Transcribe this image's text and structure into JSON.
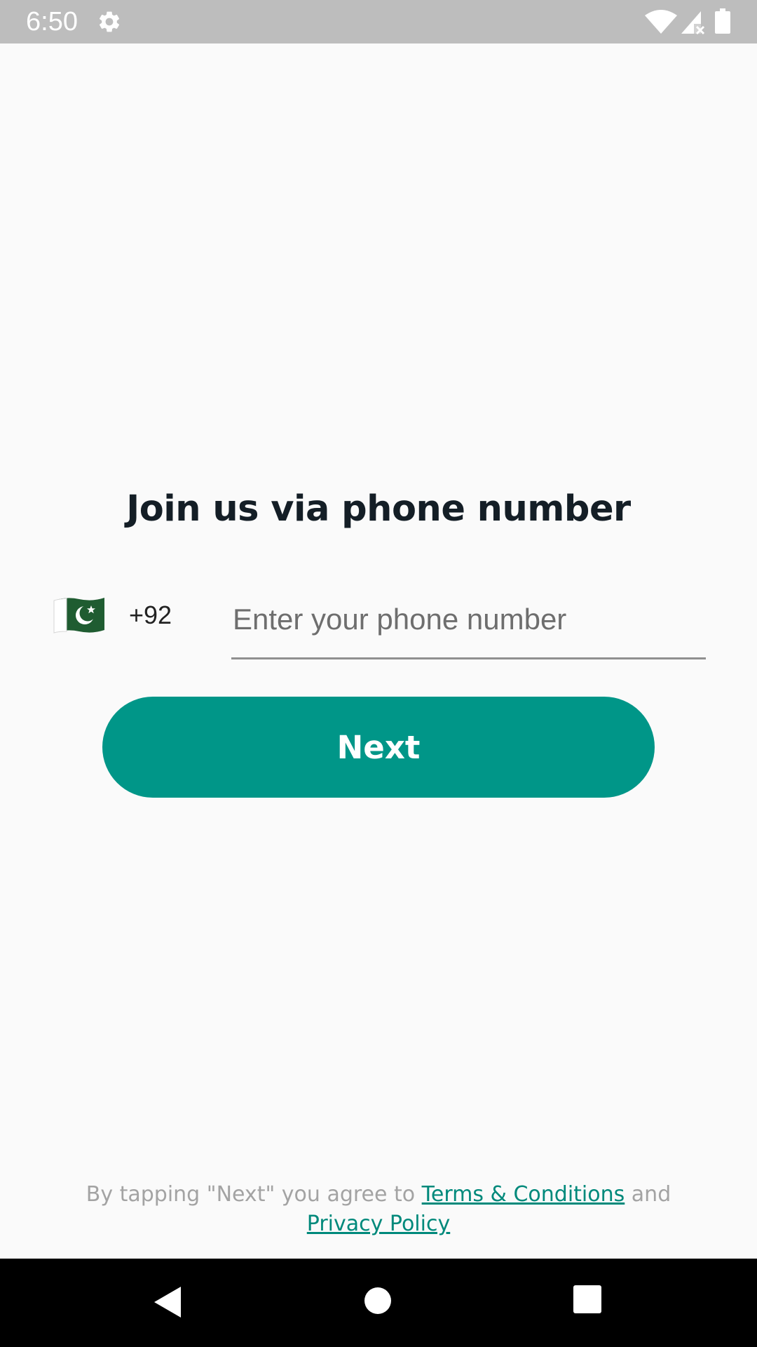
{
  "status_bar": {
    "time": "6:50",
    "icons": [
      "settings-gear-icon",
      "wifi-icon",
      "cellular-signal-no-data-icon",
      "battery-icon"
    ]
  },
  "signup": {
    "title": "Join us via phone number",
    "country_flag": "pakistan-flag-icon",
    "dial_code": "+92",
    "phone_placeholder": "Enter your phone number",
    "phone_value": "",
    "next_label": "Next"
  },
  "agreement": {
    "prefix": "By tapping \"Next\" you agree to ",
    "terms_link": "Terms & Conditions",
    "middle": " and",
    "privacy_link": "Privacy Policy"
  },
  "nav_bar": {
    "icons": [
      "back-icon",
      "home-icon",
      "recents-icon"
    ]
  },
  "colors": {
    "accent": "#009688",
    "link": "#00897b",
    "title_text": "#141e26",
    "muted_text": "#a3a3a3",
    "status_bar_bg": "#bdbdbd",
    "page_bg": "#fafafa"
  }
}
